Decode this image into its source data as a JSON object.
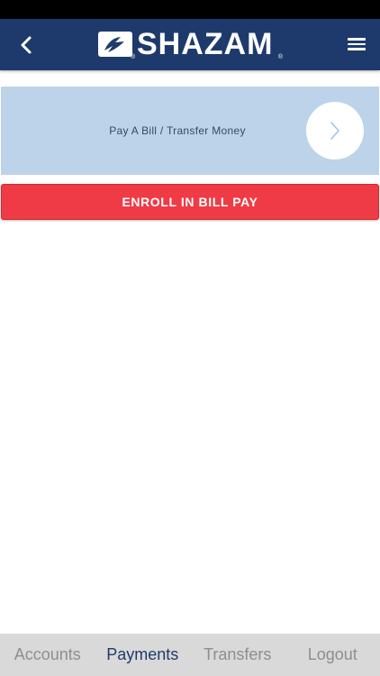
{
  "colors": {
    "navbar": "#1e3a6c",
    "card": "#bcd3ea",
    "enroll": "#ef3b45",
    "tab_active": "#1e3a6c",
    "tab_inactive": "#8e8e93"
  },
  "header": {
    "back_icon": "chevron-left-icon",
    "logo_text": "SHAZAM",
    "logo_reg_mark": "®",
    "menu_icon": "hamburger-menu-icon"
  },
  "main": {
    "pay_card_label": "Pay A Bill / Transfer Money",
    "pay_card_icon": "chevron-right-icon",
    "enroll_label": "ENROLL IN BILL PAY"
  },
  "tabs": [
    {
      "label": "Accounts",
      "active": false
    },
    {
      "label": "Payments",
      "active": true
    },
    {
      "label": "Transfers",
      "active": false
    },
    {
      "label": "Logout",
      "active": false
    }
  ]
}
